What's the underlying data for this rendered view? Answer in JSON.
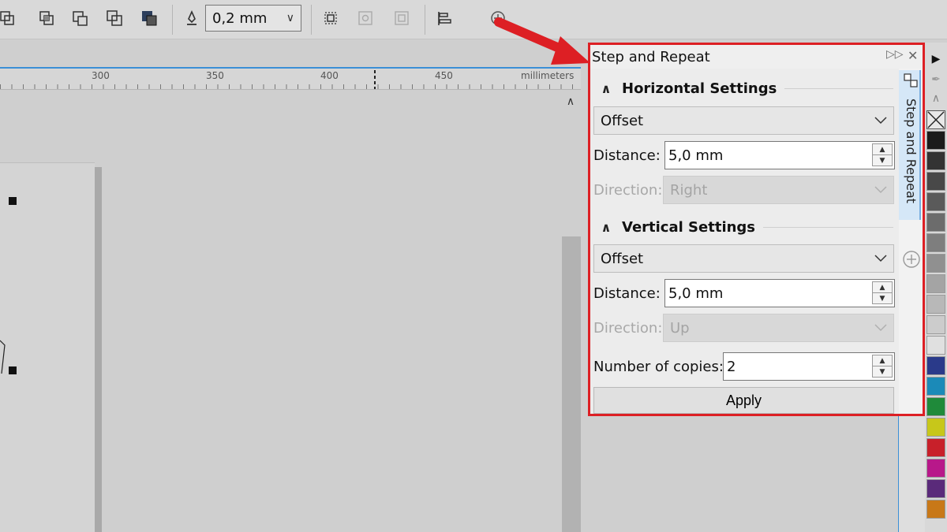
{
  "toolbar": {
    "outline_width": "0,2 mm",
    "icons": [
      "combine-icon",
      "weld-icon",
      "trim-icon",
      "intersect-icon",
      "simplify-icon",
      "outline-pen-icon",
      "group-icon",
      "ungroup-icon",
      "ungroup-all-icon",
      "align-icon",
      "add-icon"
    ]
  },
  "ruler": {
    "ticks": [
      "300",
      "350",
      "400",
      "450"
    ],
    "unit": "millimeters"
  },
  "docker": {
    "title": "Step and Repeat",
    "tab_label": "Step and Repeat",
    "horizontal": {
      "title": "Horizontal Settings",
      "mode": "Offset",
      "distance_label": "Distance:",
      "distance_value": "5,0 mm",
      "direction_label": "Direction:",
      "direction_value": "Right"
    },
    "vertical": {
      "title": "Vertical Settings",
      "mode": "Offset",
      "distance_label": "Distance:",
      "distance_value": "5,0 mm",
      "direction_label": "Direction:",
      "direction_value": "Up"
    },
    "copies_label": "Number of copies:",
    "copies_value": "2",
    "apply_label": "Apply"
  },
  "colors": {
    "highlight": "#dd1f24",
    "accent": "#3b8fd6"
  },
  "palette": [
    "#1b1b1b",
    "#333333",
    "#484848",
    "#5a5a5a",
    "#6c6c6c",
    "#7e7e7e",
    "#909090",
    "#a4a4a4",
    "#b8b8b8",
    "#cccccc",
    "#e0e0e0",
    "#2a3a8a",
    "#1b8ab8",
    "#1f8a3a",
    "#c7c71a",
    "#c8202a",
    "#b8188a",
    "#5a2a7a",
    "#c87818"
  ]
}
